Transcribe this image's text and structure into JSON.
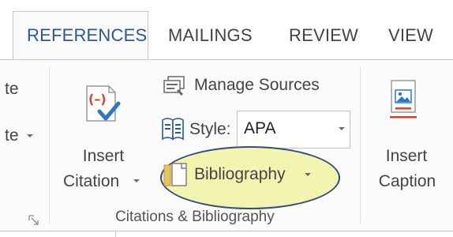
{
  "tabs": {
    "references": "REFERENCES",
    "mailings": "MAILINGS",
    "review": "REVIEW",
    "view": "VIEW"
  },
  "left_partial": {
    "item1": "te",
    "item2": "te"
  },
  "insert_citation": {
    "line1": "Insert",
    "line2": "Citation",
    "icon": "insert-citation-icon"
  },
  "manage_sources": {
    "label": "Manage Sources",
    "icon": "manage-sources-icon"
  },
  "style": {
    "label": "Style:",
    "value": "APA",
    "icon": "style-icon"
  },
  "bibliography": {
    "label": "Bibliography",
    "icon": "bibliography-icon"
  },
  "insert_caption": {
    "line1": "Insert",
    "line2": "Caption",
    "icon": "insert-caption-icon"
  },
  "group": {
    "label": "Citations & Bibliography"
  },
  "colors": {
    "accent": "#2b579a",
    "highlight_fill": "#f3f3aa",
    "highlight_border": "#2f4c7c",
    "citation_red": "#d24726",
    "check_blue": "#2b79c2"
  }
}
